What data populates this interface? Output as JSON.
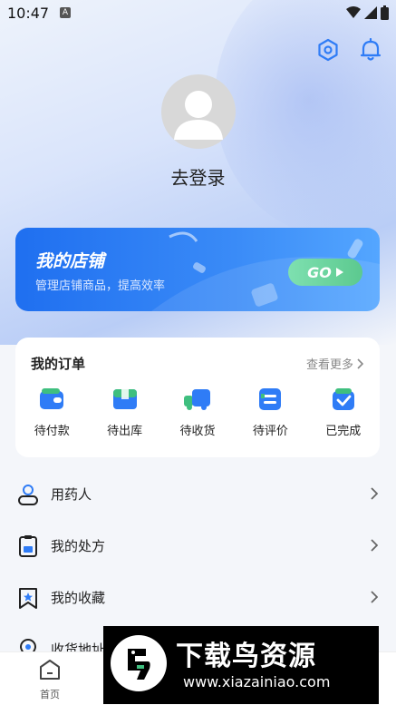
{
  "status_bar": {
    "time": "10:47",
    "badge": "A"
  },
  "profile": {
    "login_label": "去登录"
  },
  "shop_banner": {
    "title": "我的店铺",
    "subtitle": "管理店铺商品，提高效率",
    "go_label": "GO"
  },
  "orders": {
    "title": "我的订单",
    "more_label": "查看更多",
    "items": [
      {
        "label": "待付款",
        "icon": "wallet-icon"
      },
      {
        "label": "待出库",
        "icon": "package-icon"
      },
      {
        "label": "待收货",
        "icon": "truck-icon"
      },
      {
        "label": "待评价",
        "icon": "comment-icon"
      },
      {
        "label": "已完成",
        "icon": "check-box-icon"
      }
    ]
  },
  "menu": [
    {
      "label": "用药人",
      "icon": "user-icon"
    },
    {
      "label": "我的处方",
      "icon": "prescription-icon"
    },
    {
      "label": "我的收藏",
      "icon": "bookmark-star-icon"
    },
    {
      "label": "收货地址",
      "icon": "location-pin-icon"
    }
  ],
  "tabbar": {
    "home_label": "首页"
  },
  "ad": {
    "title": "下载鸟资源",
    "url": "www.xiazainiao.com"
  },
  "colors": {
    "brand_blue": "#1f6ff0",
    "go_green": "#5cc98f",
    "icon_blue": "#2f7cf6",
    "icon_green": "#3fbf7f"
  }
}
